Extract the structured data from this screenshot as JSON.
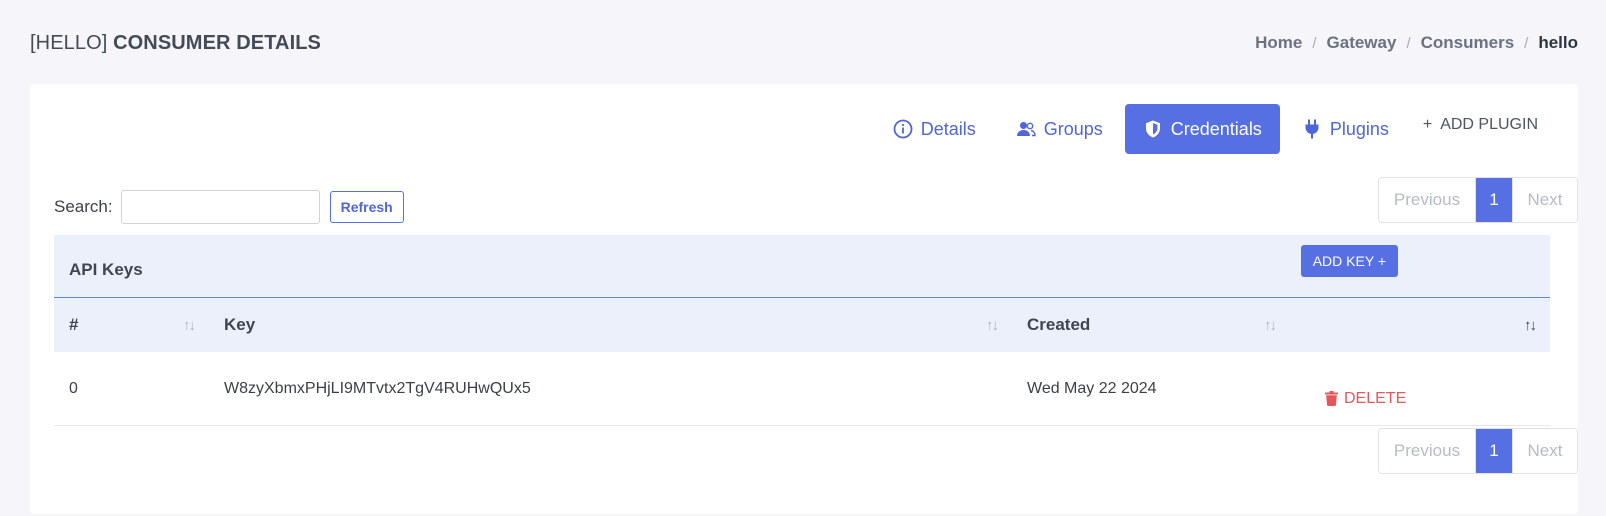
{
  "header": {
    "title_bracket": "[HELLO]",
    "title_rest": "CONSUMER DETAILS",
    "breadcrumb": [
      "Home",
      "Gateway",
      "Consumers",
      "hello"
    ],
    "separator": "/"
  },
  "tabs": [
    {
      "label": "Details",
      "icon": "info-circle-icon"
    },
    {
      "label": "Groups",
      "icon": "users-icon"
    },
    {
      "label": "Credentials",
      "icon": "shield-icon",
      "active": true
    },
    {
      "label": "Plugins",
      "icon": "plug-icon"
    }
  ],
  "add_plugin_label": "ADD PLUGIN",
  "search": {
    "label": "Search:",
    "value": "",
    "placeholder": ""
  },
  "refresh_label": "Refresh",
  "pagination": {
    "previous": "Previous",
    "page": "1",
    "next": "Next"
  },
  "table": {
    "caption": "API Keys",
    "add_key_label": "ADD KEY",
    "columns": [
      "#",
      "Key",
      "Created",
      ""
    ],
    "rows": [
      {
        "index": "0",
        "key": "W8zyXbmxPHjLI9MTvtx2TgV4RUHwQUx5",
        "created": "Wed May 22 2024",
        "action": "DELETE"
      }
    ]
  },
  "colors": {
    "accent": "#5670e4",
    "danger": "#e6575b",
    "header_bg": "#ebf0fb"
  }
}
